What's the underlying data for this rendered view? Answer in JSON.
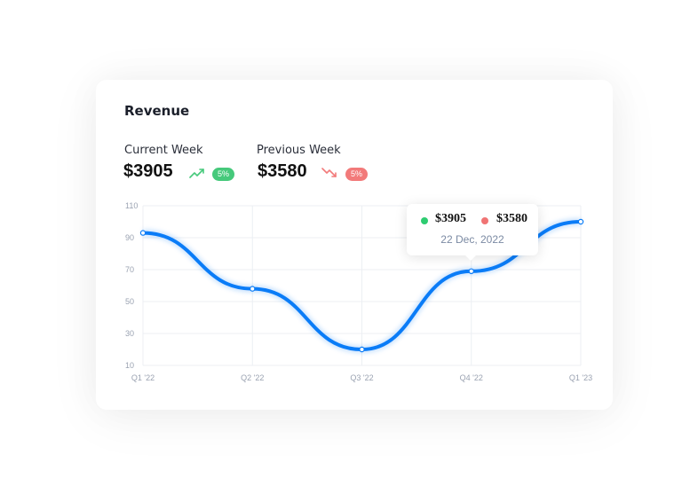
{
  "card": {
    "title": "Revenue",
    "current": {
      "label": "Current Week",
      "value": "$3905",
      "badge": "5%",
      "trend": "up"
    },
    "previous": {
      "label": "Previous Week",
      "value": "$3580",
      "badge": "5%",
      "trend": "down"
    }
  },
  "tooltip": {
    "value_a": "$3905",
    "value_b": "$3580",
    "date": "22 Dec, 2022",
    "color_a": "#2ecc71",
    "color_b": "#f07474"
  },
  "colors": {
    "line": "#0a7cf7",
    "up": "#46c97b",
    "down": "#f27a7a",
    "grid": "#eceff3"
  },
  "chart_data": {
    "type": "line",
    "categories": [
      "Q1 '22",
      "Q2 '22",
      "Q3 '22",
      "Q4 '22",
      "Q1 '23"
    ],
    "series": [
      {
        "values": [
          93,
          58,
          20,
          69,
          100
        ]
      }
    ],
    "y_ticks": [
      10,
      30,
      50,
      70,
      90,
      110
    ],
    "ylim": [
      10,
      110
    ],
    "grid": true,
    "smooth": true,
    "title": "",
    "xlabel": "",
    "ylabel": ""
  }
}
